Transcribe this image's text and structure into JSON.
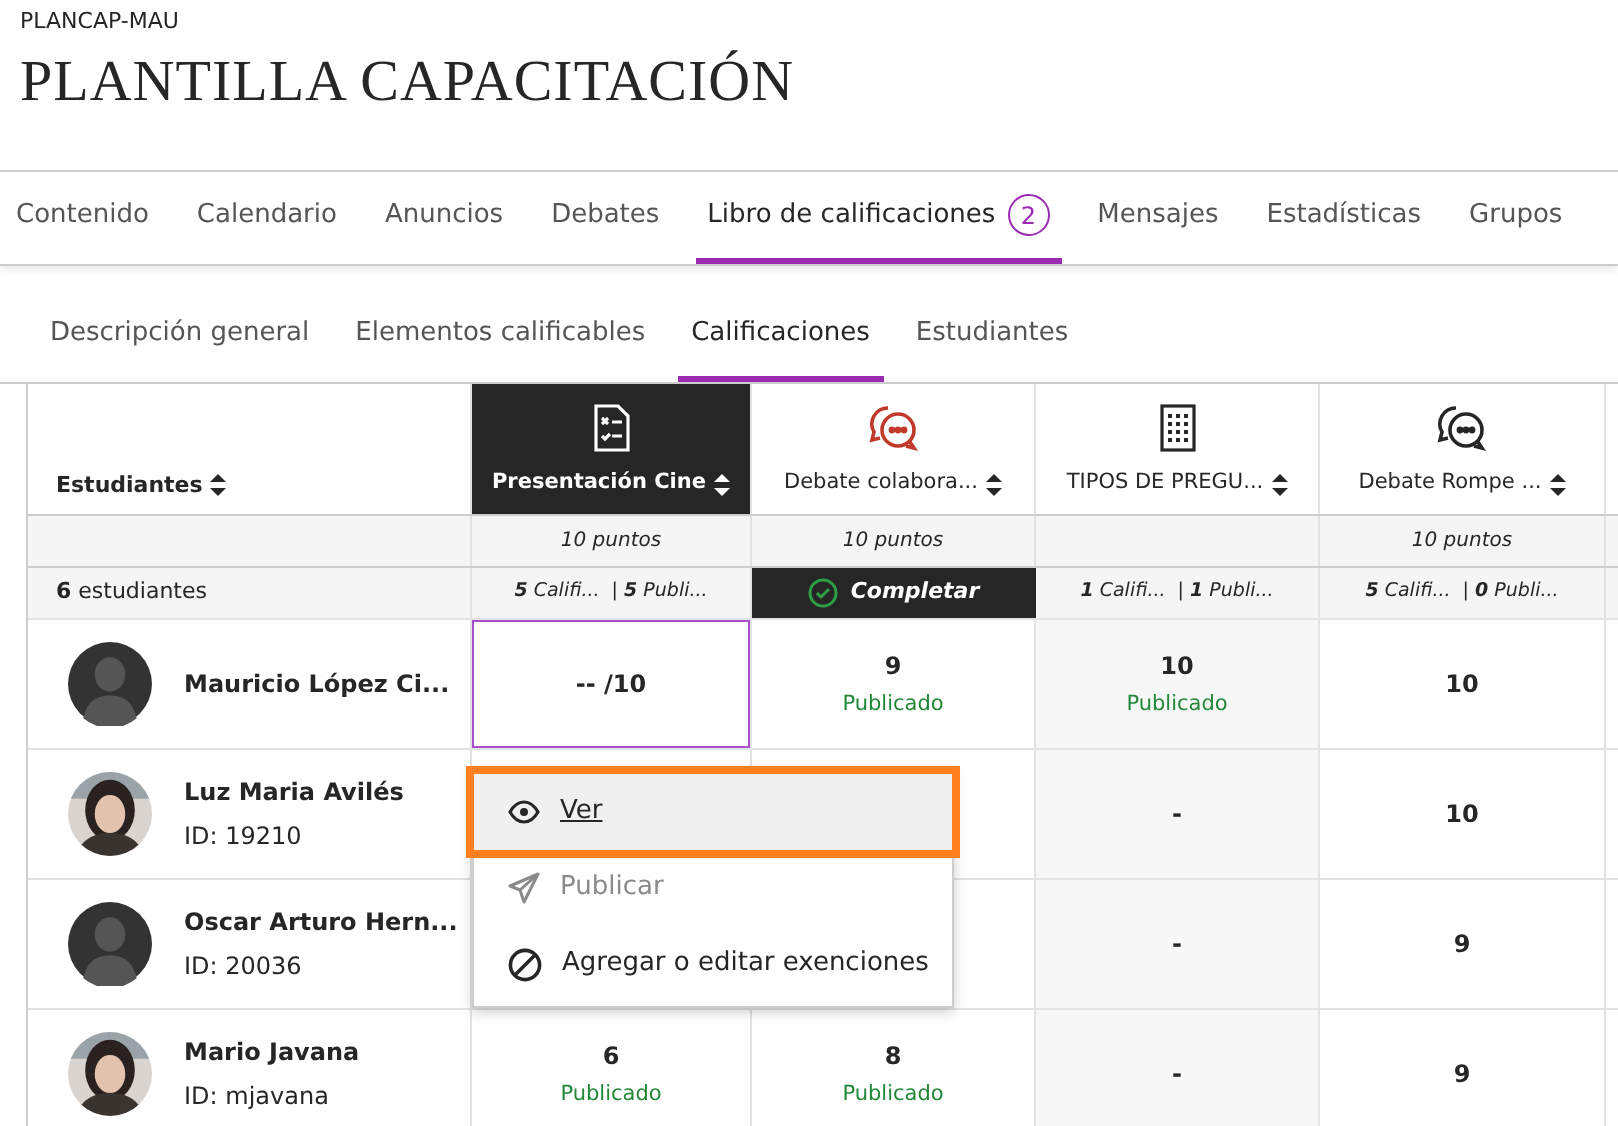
{
  "course": {
    "code": "PLANCAP-MAU",
    "title": "PLANTILLA CAPACITACIÓN"
  },
  "tabs": [
    {
      "label": "Contenido",
      "selected": false
    },
    {
      "label": "Calendario",
      "selected": false
    },
    {
      "label": "Anuncios",
      "selected": false
    },
    {
      "label": "Debates",
      "selected": false
    },
    {
      "label": "Libro de calificaciones",
      "selected": true,
      "badge": "2"
    },
    {
      "label": "Mensajes",
      "selected": false
    },
    {
      "label": "Estadísticas",
      "selected": false
    },
    {
      "label": "Grupos",
      "selected": false
    }
  ],
  "subtabs": [
    {
      "label": "Descripción general",
      "selected": false
    },
    {
      "label": "Elementos calificables",
      "selected": false
    },
    {
      "label": "Calificaciones",
      "selected": true
    },
    {
      "label": "Estudiantes",
      "selected": false
    }
  ],
  "table": {
    "student_header": "Estudiantes",
    "student_count": "**6** estudiantes",
    "columns": [
      {
        "kind": "test",
        "title": "Presentación Cine",
        "selected": true,
        "points": "10 puntos",
        "summary": {
          "kind": "counts",
          "graded": "**5** Califi...",
          "published": "| **5** Publi..."
        }
      },
      {
        "kind": "discussion",
        "color": "#c0392b",
        "title": "Debate colabora...",
        "selected": false,
        "points": "10 puntos",
        "summary": {
          "kind": "complete",
          "status": "Completar"
        }
      },
      {
        "kind": "calculation",
        "title": "TIPOS DE PREGU...",
        "selected": false,
        "summary": {
          "kind": "counts",
          "graded": "**1** Califi...",
          "published": "| **1** Publi..."
        }
      },
      {
        "kind": "discussion",
        "color": "#262626",
        "title": "Debate Rompe ...",
        "selected": false,
        "points": "10 puntos",
        "summary": {
          "kind": "counts",
          "graded": "**5** Califi...",
          "published": "| **0** Publi..."
        }
      }
    ],
    "rows": [
      {
        "kind": "silhouette",
        "name": "Mauricio López Ci...",
        "cells": [
          {
            "grade": "-- /10",
            "selected": true
          },
          {
            "grade": "9",
            "status": "Publicado",
            "selected": false
          },
          {
            "grade": "10",
            "status": "Publicado",
            "selected": false
          },
          {
            "grade": "10",
            "selected": false
          }
        ]
      },
      {
        "kind": "picture",
        "name": "Luz Maria Avilés",
        "id": "ID: 19210",
        "cells": [
          null,
          null,
          {
            "grade": "-",
            "selected": false
          },
          {
            "grade": "10",
            "selected": false
          }
        ]
      },
      {
        "kind": "silhouette",
        "name": "Oscar Arturo Hern...",
        "id": "ID: 20036",
        "cells": [
          null,
          null,
          {
            "grade": "-",
            "selected": false
          },
          {
            "grade": "9",
            "selected": false
          }
        ]
      },
      {
        "kind": "picture",
        "name": "Mario Javana",
        "id": "ID: mjavana",
        "cells": [
          {
            "grade": "6",
            "status": "Publicado",
            "selected": false
          },
          {
            "grade": "8",
            "status": "Publicado",
            "selected": false
          },
          {
            "grade": "-",
            "selected": false
          },
          {
            "grade": "9",
            "selected": false
          }
        ]
      }
    ]
  },
  "menu": [
    {
      "kind": "eye",
      "label": "Ver",
      "highlighted": true,
      "disabled": false
    },
    {
      "kind": "send",
      "label": "Publicar",
      "highlighted": false,
      "disabled": true
    },
    {
      "kind": "ban",
      "label": "Agregar o editar exenciones",
      "highlighted": false,
      "disabled": false
    }
  ]
}
